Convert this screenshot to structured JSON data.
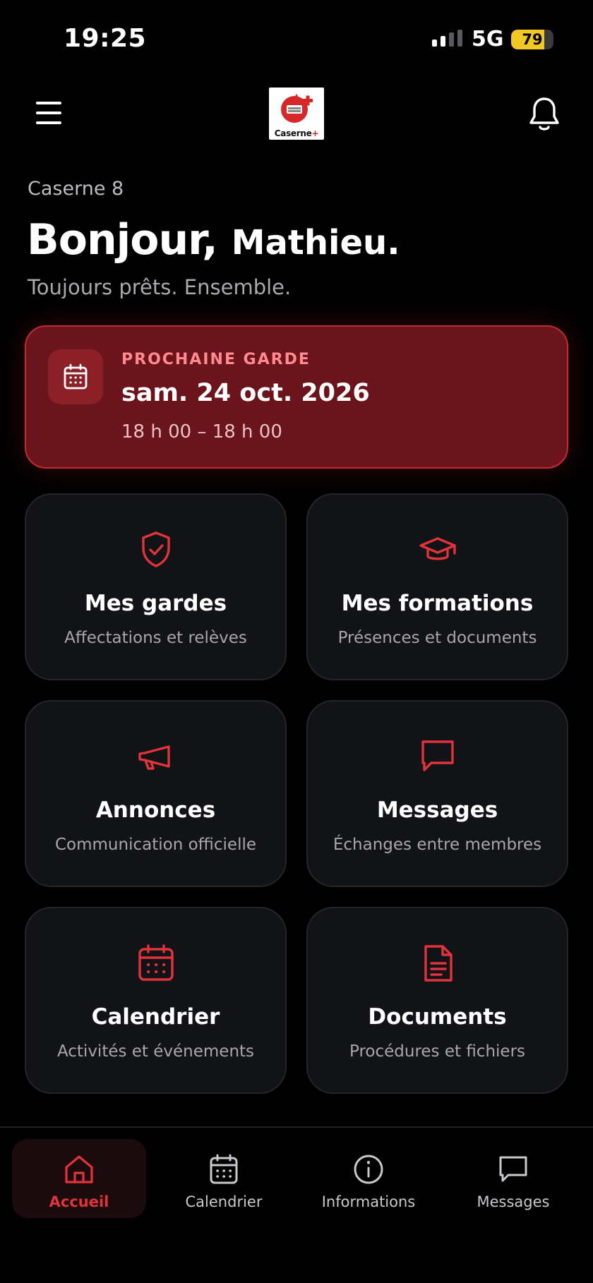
{
  "status_bar": {
    "time": "19:25",
    "network": "5G",
    "battery": "79",
    "battery_level": 0.79
  },
  "header": {
    "logo_text": "Caserne",
    "logo_plus": "+"
  },
  "greeting": {
    "station": "Caserne 8",
    "hello": "Bonjour,",
    "name": "Mathieu.",
    "tagline": "Toujours prêts. Ensemble."
  },
  "next_shift": {
    "label": "PROCHAINE GARDE",
    "date": "sam. 24 oct. 2026",
    "time": "18 h 00 – 18 h 00",
    "icon": "calendar-icon"
  },
  "tiles": [
    {
      "title": "Mes gardes",
      "subtitle": "Affectations et relèves",
      "icon": "shield-check-icon"
    },
    {
      "title": "Mes formations",
      "subtitle": "Présences et documents",
      "icon": "graduation-cap-icon"
    },
    {
      "title": "Annonces",
      "subtitle": "Communication officielle",
      "icon": "megaphone-icon"
    },
    {
      "title": "Messages",
      "subtitle": "Échanges entre membres",
      "icon": "message-icon"
    },
    {
      "title": "Calendrier",
      "subtitle": "Activités et événements",
      "icon": "calendar-icon"
    },
    {
      "title": "Documents",
      "subtitle": "Procédures et fichiers",
      "icon": "document-icon"
    }
  ],
  "bottom_nav": [
    {
      "label": "Accueil",
      "icon": "home-icon",
      "active": true
    },
    {
      "label": "Calendrier",
      "icon": "calendar-icon",
      "active": false
    },
    {
      "label": "Informations",
      "icon": "info-icon",
      "active": false
    },
    {
      "label": "Messages",
      "icon": "message-icon",
      "active": false
    }
  ],
  "colors": {
    "accent": "#e0333a",
    "card_bg": "#121316",
    "shift_bg": "#6c141c",
    "battery": "#f2c824"
  }
}
